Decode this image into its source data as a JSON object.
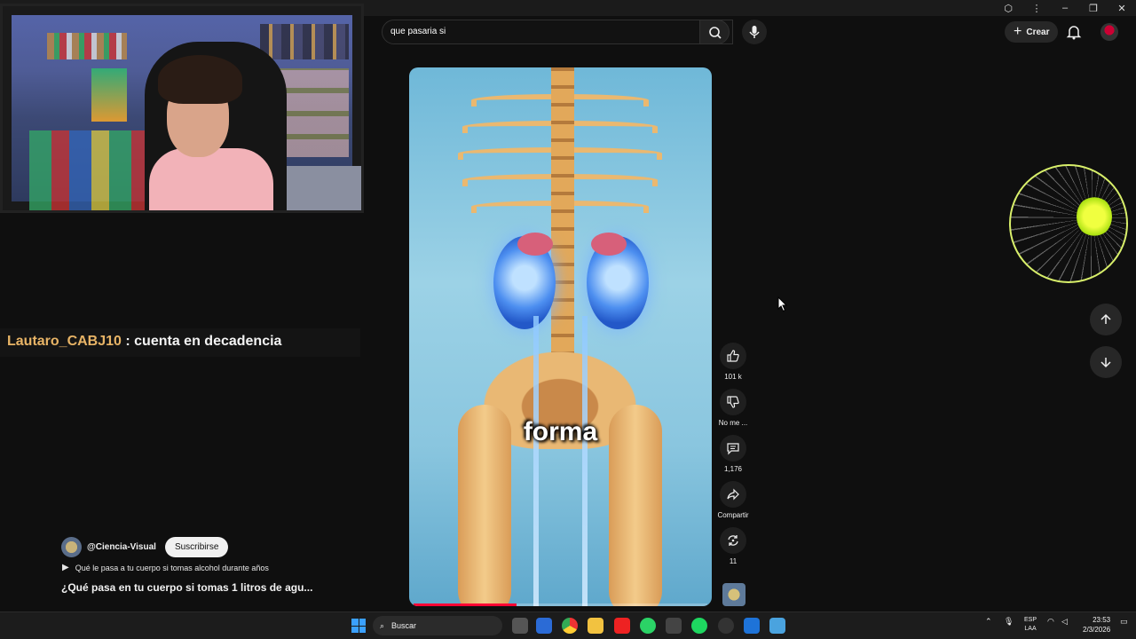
{
  "search": {
    "query": "que pasaria si"
  },
  "header": {
    "create_label": "Crear"
  },
  "chat": {
    "username": "Lautaro_CABJ10",
    "separator": " : ",
    "message": "cuenta en decadencia"
  },
  "video": {
    "caption": "forma",
    "progress": 0.35
  },
  "channel": {
    "handle": "@Ciencia-Visual",
    "subscribe_label": "Suscribirse"
  },
  "related_short": "Qué le pasa a tu cuerpo si tomas alcohol durante años",
  "short_title": "¿Qué pasa en tu cuerpo si tomas 1 litros de agu...",
  "actions": {
    "like_count": "101 k",
    "dislike_label": "No me ...",
    "comments_count": "1,176",
    "share_label": "Compartir",
    "remix_count": "11"
  },
  "taskbar": {
    "search_placeholder": "Buscar",
    "lang": "ESP",
    "region": "LAA",
    "time": "23:53",
    "date": "2/3/2026"
  },
  "colors": {
    "accent": "#ff0033",
    "chat_user": "#e8b466",
    "burst_ring": "#d8ef6a"
  },
  "icons": [
    "search-icon",
    "clear-icon",
    "mic-icon",
    "plus-icon",
    "bell-icon",
    "like-icon",
    "dislike-icon",
    "comment-icon",
    "share-icon",
    "remix-icon",
    "arrow-up-icon",
    "arrow-down-icon",
    "play-icon",
    "windows-icon"
  ]
}
